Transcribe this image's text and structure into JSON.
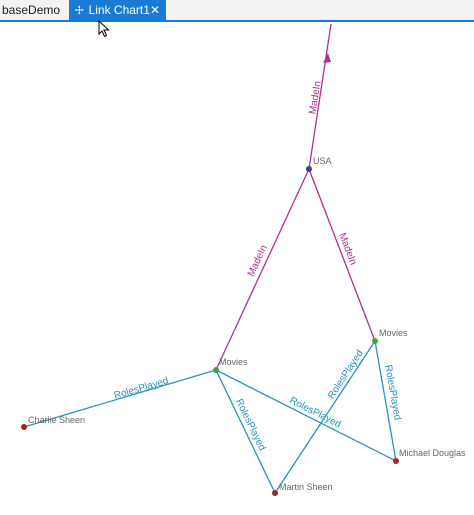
{
  "tabs": [
    {
      "label": "baseDemo",
      "active": false
    },
    {
      "label": "Link Chart1",
      "active": true,
      "icon": "link-chart-icon",
      "close_icon": "close-icon"
    }
  ],
  "colors": {
    "accent": "#1a7bd6",
    "madeIn": "#b0308f",
    "rolesPlayed": "#2a93b8",
    "nodeGreen": "#3aa64a",
    "nodeRed": "#a0232b",
    "nodeBlue": "#2f3fa6",
    "nodeLabel": "#666666"
  },
  "nodes": {
    "usa": "USA",
    "movies1": "Movies",
    "movies2": "Movies",
    "charlie": "Charlie Sheen",
    "michael": "Michael Douglas",
    "martin": "Martin Sheen"
  },
  "edges": {
    "madeIn": "MadeIn",
    "rolesPlayed": "RolesPlayed"
  }
}
